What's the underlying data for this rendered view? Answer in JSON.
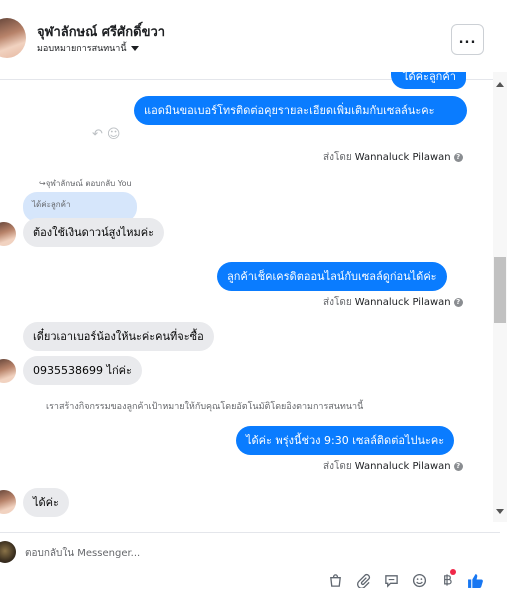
{
  "header": {
    "contact_name": "จุฬาลักษณ์ ศรีศักดิ์ขวา",
    "assign_label": "มอบหมายการสนทนานี้",
    "more_label": "..."
  },
  "messages": {
    "out_partial": "ได้ค่ะลูกค้า",
    "out_1": "แอดมินขอเบอร์โทรติดต่อคุยรายละเอียดเพิ่มเติมกับเซลล์นะคะ",
    "sent_by_1_prefix": "ส่งโดย",
    "sent_by_1_name": "Wannaluck Pilawan",
    "reply_note": "↪จุฬาลักษณ์ ตอบกลับ You",
    "quoted_text": "ได้ค่ะลูกค้า",
    "in_1": "ต้องใช้เงินดาวน์สูงไหมค่ะ",
    "out_2": "ลูกค้าเช็คเครดิตออนไลน์กับเซลล์ดูก่อนได้ค่ะ",
    "sent_by_2_prefix": "ส่งโดย",
    "sent_by_2_name": "Wannaluck Pilawan",
    "in_2": "เดี๋ยวเอาเบอร์น้องให้นะค่ะคนที่จะซื้อ",
    "in_3": "0935538699 ไก่ค่ะ",
    "system_note": "เราสร้างกิจกรรมของลูกค้าเป้าหมายให้กับคุณโดยอัตโนมัติโดยอิงตามการสนทนานี้",
    "out_3": "ได้ค่ะ พรุ่งนี้ช่วง 9:30 เซลล์ติดต่อไปนะคะ",
    "sent_by_3_prefix": "ส่งโดย",
    "sent_by_3_name": "Wannaluck Pilawan",
    "in_4": "ได้ค่ะ"
  },
  "composer": {
    "placeholder": "ตอบกลับใน Messenger..."
  },
  "toolbar_icons": [
    "shopping-bag-icon",
    "paperclip-icon",
    "saved-reply-icon",
    "emoji-icon",
    "baht-payment-icon",
    "thumbs-up-icon"
  ],
  "colors": {
    "outgoing_bubble": "#0a7cff",
    "incoming_bubble": "#e9eaed",
    "like_blue": "#1877f2"
  }
}
